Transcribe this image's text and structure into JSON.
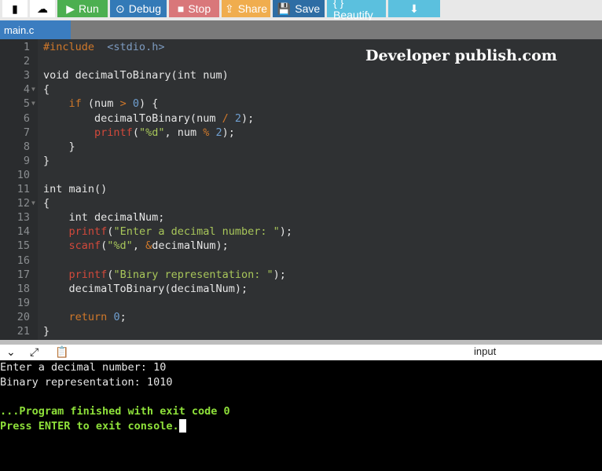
{
  "toolbar": {
    "new_icon": "file-icon",
    "upload_icon": "upload-icon",
    "buttons": [
      {
        "label": "Run",
        "icon": "▶",
        "color": "#4caf50"
      },
      {
        "label": "Debug",
        "icon": "⊙",
        "color": "#337ab7"
      },
      {
        "label": "Stop",
        "icon": "■",
        "color": "#d9777a"
      },
      {
        "label": "Share",
        "icon": "⇪",
        "color": "#f0ad4e"
      },
      {
        "label": "Save",
        "icon": "💾",
        "color": "#2e6da4"
      },
      {
        "label": "{ } Beautify",
        "icon": "",
        "color": "#5bc0de"
      },
      {
        "label": "",
        "icon": "⬇",
        "color": "#5bc0de"
      }
    ]
  },
  "tab": {
    "label": "main.c"
  },
  "watermark": "Developer publish.com",
  "code": [
    [
      [
        "pp",
        "#include"
      ],
      [
        "",
        "  "
      ],
      [
        "inc",
        "<stdio.h>"
      ]
    ],
    [],
    [
      [
        "kw",
        "void decimalToBinary(int num)"
      ]
    ],
    [
      [
        "",
        "{"
      ]
    ],
    [
      [
        "",
        "    "
      ],
      [
        "ctl",
        "if"
      ],
      [
        "",
        " (num "
      ],
      [
        "op",
        ">"
      ],
      [
        "",
        " "
      ],
      [
        "num",
        "0"
      ],
      [
        "",
        ") {"
      ]
    ],
    [
      [
        "",
        "        decimalToBinary(num "
      ],
      [
        "op",
        "/"
      ],
      [
        "",
        " "
      ],
      [
        "num",
        "2"
      ],
      [
        "",
        ");"
      ]
    ],
    [
      [
        "",
        "        "
      ],
      [
        "fn",
        "printf"
      ],
      [
        "",
        "("
      ],
      [
        "str",
        "\"%d\""
      ],
      [
        "",
        ", num "
      ],
      [
        "op",
        "%"
      ],
      [
        "",
        " "
      ],
      [
        "num",
        "2"
      ],
      [
        "",
        ");"
      ]
    ],
    [
      [
        "",
        "    }"
      ]
    ],
    [
      [
        "",
        "}"
      ]
    ],
    [],
    [
      [
        "",
        "int main()"
      ]
    ],
    [
      [
        "",
        "{"
      ]
    ],
    [
      [
        "",
        "    int decimalNum;"
      ]
    ],
    [
      [
        "",
        "    "
      ],
      [
        "fn",
        "printf"
      ],
      [
        "",
        "("
      ],
      [
        "str",
        "\"Enter a decimal number: \""
      ],
      [
        "",
        ");"
      ]
    ],
    [
      [
        "",
        "    "
      ],
      [
        "fn",
        "scanf"
      ],
      [
        "",
        "("
      ],
      [
        "str",
        "\"%d\""
      ],
      [
        "",
        ", "
      ],
      [
        "op",
        "&"
      ],
      [
        "",
        "decimalNum);"
      ]
    ],
    [],
    [
      [
        "",
        "    "
      ],
      [
        "fn",
        "printf"
      ],
      [
        "",
        "("
      ],
      [
        "str",
        "\"Binary representation: \""
      ],
      [
        "",
        ");"
      ]
    ],
    [
      [
        "",
        "    decimalToBinary(decimalNum);"
      ]
    ],
    [],
    [
      [
        "",
        "    "
      ],
      [
        "ctl",
        "return"
      ],
      [
        "",
        " "
      ],
      [
        "num",
        "0"
      ],
      [
        "",
        ";"
      ]
    ],
    [
      [
        "",
        "}"
      ]
    ]
  ],
  "fold_lines": [
    4,
    5,
    12
  ],
  "console": {
    "input_label": "input",
    "lines": [
      {
        "text": "Enter a decimal number: 10",
        "style": ""
      },
      {
        "text": "Binary representation: 1010",
        "style": ""
      },
      {
        "text": "",
        "style": ""
      },
      {
        "text": "...Program finished with exit code 0",
        "style": "green"
      },
      {
        "text": "Press ENTER to exit console.",
        "style": "green"
      }
    ]
  }
}
